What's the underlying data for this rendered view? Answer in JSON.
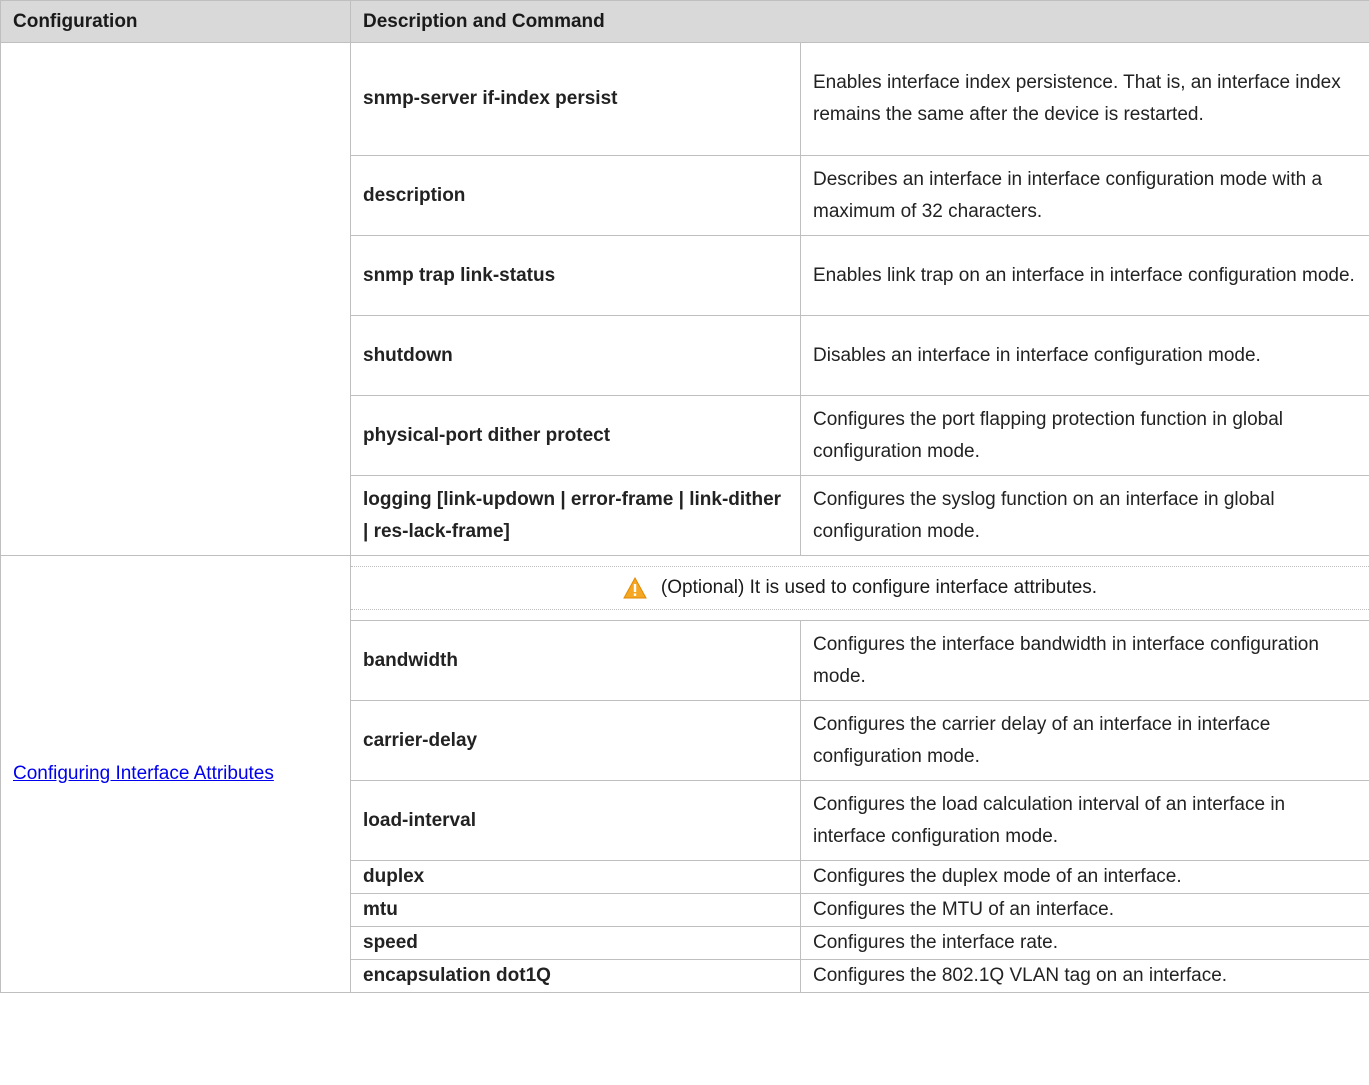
{
  "header": {
    "configuration": "Configuration",
    "description_and_command": "Description and Command"
  },
  "section1_rows": [
    {
      "command": "snmp-server if-index persist",
      "description": "Enables interface index persistence. That is, an interface index remains the same after the device is restarted."
    },
    {
      "command": "description",
      "description": "Describes an interface in interface configuration mode with a maximum of 32 characters."
    },
    {
      "command": "snmp trap link-status",
      "description": "Enables link trap on an interface in interface configuration mode."
    },
    {
      "command": "shutdown",
      "description": "Disables an interface in interface configuration mode."
    },
    {
      "command": "physical-port dither protect",
      "description": "Configures the port flapping protection function in global configuration mode."
    },
    {
      "command": "logging [link-updown | error-frame | link-dither | res-lack-frame]",
      "description": "Configures the syslog function on an interface in global configuration mode."
    }
  ],
  "section2": {
    "configuration_link": "Configuring Interface Attributes",
    "note": "(Optional) It is used to configure interface attributes.",
    "note_icon": "warning-icon",
    "warning_color": "#f5a623"
  },
  "section2_rows": [
    {
      "command": "bandwidth",
      "description": "Configures the interface bandwidth in interface configuration mode."
    },
    {
      "command": "carrier-delay",
      "description": "Configures the carrier delay of an interface in interface configuration mode."
    },
    {
      "command": "load-interval",
      "description": "Configures the load calculation interval of an interface in interface configuration mode."
    },
    {
      "command": "duplex",
      "description": "Configures the duplex mode of an interface."
    },
    {
      "command": "mtu",
      "description": "Configures the MTU of an interface."
    },
    {
      "command": "speed",
      "description": "Configures the interface rate."
    },
    {
      "command": "encapsulation dot1Q",
      "description": "Configures the 802.1Q VLAN tag on an interface."
    }
  ]
}
